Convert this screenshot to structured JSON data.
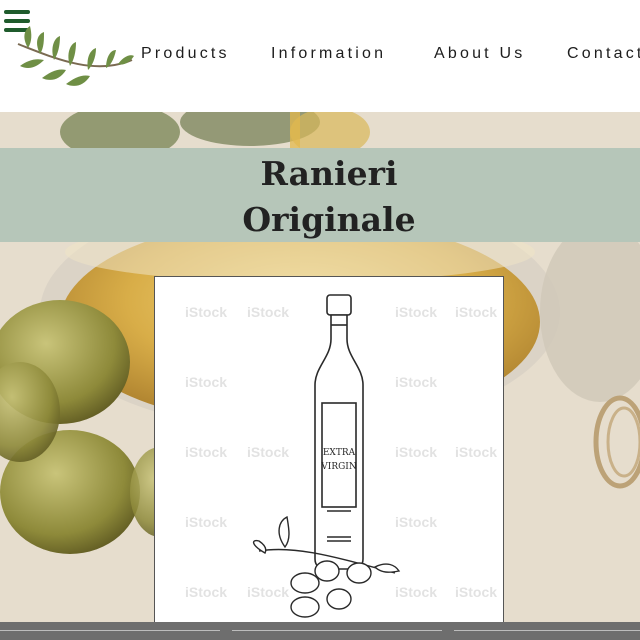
{
  "header": {
    "nav": [
      {
        "label": "Products"
      },
      {
        "label": "Information"
      },
      {
        "label": "About Us"
      },
      {
        "label": "Contact"
      }
    ]
  },
  "hero": {
    "title_line1": "Ranieri",
    "title_line2": "Originale"
  },
  "product_image": {
    "label_line1": "EXTRA",
    "label_line2": "VIRGIN",
    "watermark": "iStock"
  },
  "colors": {
    "menu_icon": "#1f5b2c",
    "title_band": "#b6c6b9",
    "title_text": "#222222",
    "nav_text": "#1d1d1d"
  },
  "icons": [
    "hamburger-menu-icon",
    "olive-branch-logo"
  ]
}
